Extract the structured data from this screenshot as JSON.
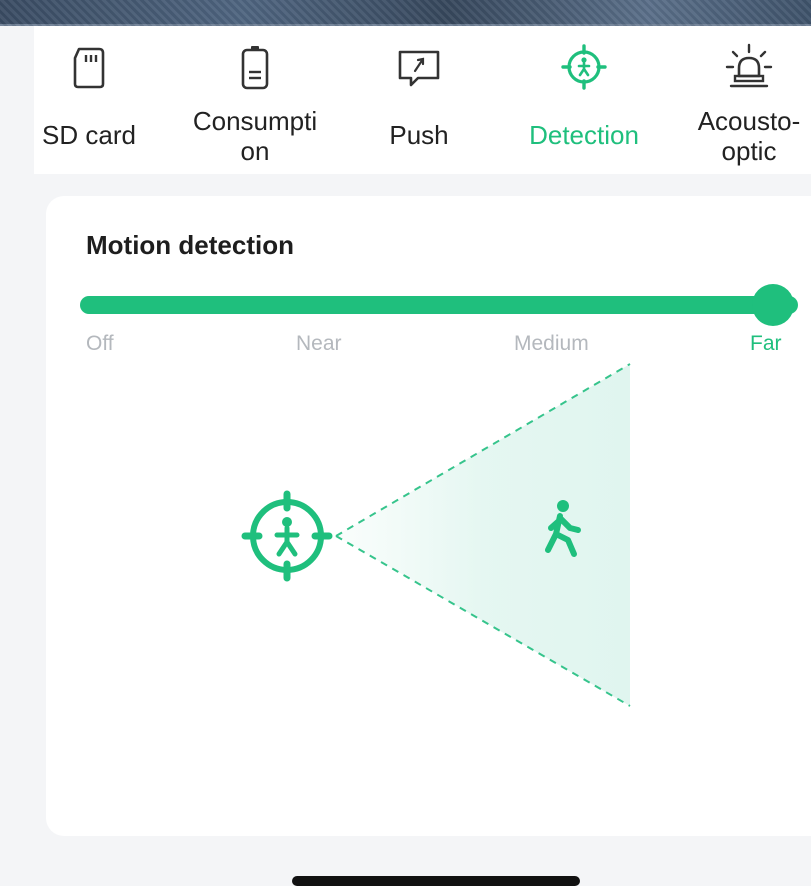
{
  "colors": {
    "accent": "#1fbf7d",
    "inactive_text": "#b4b8bd",
    "page_bg": "#f4f5f7"
  },
  "toolbar": {
    "items": [
      {
        "label": "SD card",
        "icon": "sd-card-icon",
        "active": false
      },
      {
        "label": "Consumpti\non",
        "icon": "battery-icon",
        "active": false
      },
      {
        "label": "Push",
        "icon": "push-message-icon",
        "active": false
      },
      {
        "label": "Detection",
        "icon": "detection-target-icon",
        "active": true
      },
      {
        "label": "Acousto-\noptic",
        "icon": "alarm-light-icon",
        "active": false
      }
    ]
  },
  "motion_detection": {
    "title": "Motion detection",
    "levels": [
      "Off",
      "Near",
      "Medium",
      "Far"
    ],
    "selected_level": "Far",
    "value_fraction": 1.0
  },
  "diagram": {
    "sensor_icon": "detection-target-icon",
    "subject_icon": "walking-person-icon"
  }
}
